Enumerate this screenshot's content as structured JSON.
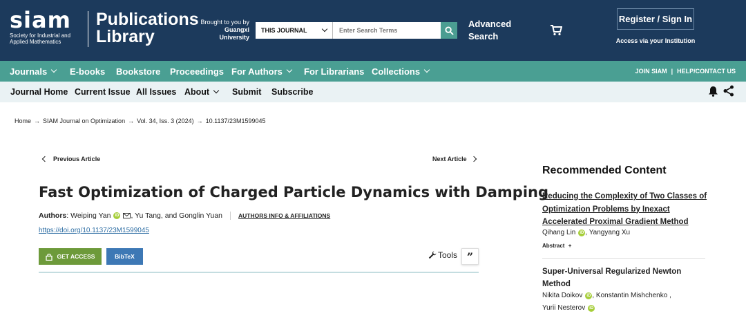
{
  "header": {
    "logo_word": "siam",
    "logo_sub_line1": "Society for Industrial and",
    "logo_sub_line2": "Applied Mathematics",
    "pubs_line1": "Publications",
    "pubs_line2": "Library",
    "brought_line1": "Brought to you by",
    "brought_line2": "Guangxi",
    "brought_line3": "University",
    "search_scope": "THIS JOURNAL",
    "search_placeholder": "Enter Search Terms",
    "advanced_line1": "Advanced",
    "advanced_line2": "Search",
    "register": "Register / Sign In",
    "institution": "Access via your Institution"
  },
  "nav": {
    "items": [
      "Journals",
      "E-books",
      "Bookstore",
      "Proceedings",
      "For Authors",
      "For Librarians",
      "Collections"
    ],
    "join": "JOIN SIAM",
    "sep": "|",
    "help": "HELP/CONTACT US"
  },
  "journal_nav": {
    "items": [
      "Journal Home",
      "Current Issue",
      "All Issues",
      "About",
      "Submit",
      "Subscribe"
    ]
  },
  "breadcrumb": [
    "Home",
    "SIAM Journal on Optimization",
    "Vol. 34, Iss. 3 (2024)",
    "10.1137/23M1599045"
  ],
  "article": {
    "prev": "Previous Article",
    "next": "Next Article",
    "title": "Fast Optimization of Charged Particle Dynamics with Damping",
    "authors_label": "Authors",
    "author1": "Weiping Yan",
    "author_rest": ", Yu Tang, and Gonglin Yuan",
    "affiliations": "AUTHORS INFO & AFFILIATIONS",
    "doi": "https://doi.org/10.1137/23M1599045",
    "get_access": "GET ACCESS",
    "bibtex": "BibTeX",
    "tools": "Tools",
    "quote_icon": "”"
  },
  "recommended": {
    "heading": "Recommended Content",
    "item1_title": "Reducing the Complexity of Two Classes of Optimization Problems by Inexact Accelerated Proximal Gradient Method",
    "item1_author1": "Qihang Lin",
    "item1_author2": ", Yangyang Xu",
    "item1_abstract": "Abstract",
    "item1_plus": "+",
    "item2_title": "Super-Universal Regularized Newton Method",
    "item2_author1": "Nikita Doikov",
    "item2_author2": ", Konstantin Mishchenko ,",
    "item2_author3": "Yurii Nesterov"
  },
  "colors": {
    "header_bg": "#1c3a5c",
    "nav_bg": "#4a9f93",
    "journal_nav_bg": "#eaf2f4",
    "access_green": "#6d9a3a",
    "bibtex_blue": "#3d78b5",
    "orcid_green": "#a6ce39",
    "link_blue": "#2d6da3"
  },
  "icons": [
    "search-icon",
    "cart-icon",
    "bell-icon",
    "share-icon",
    "lock-icon",
    "wrench-icon",
    "quote-icon",
    "orcid-icon",
    "mail-icon"
  ]
}
